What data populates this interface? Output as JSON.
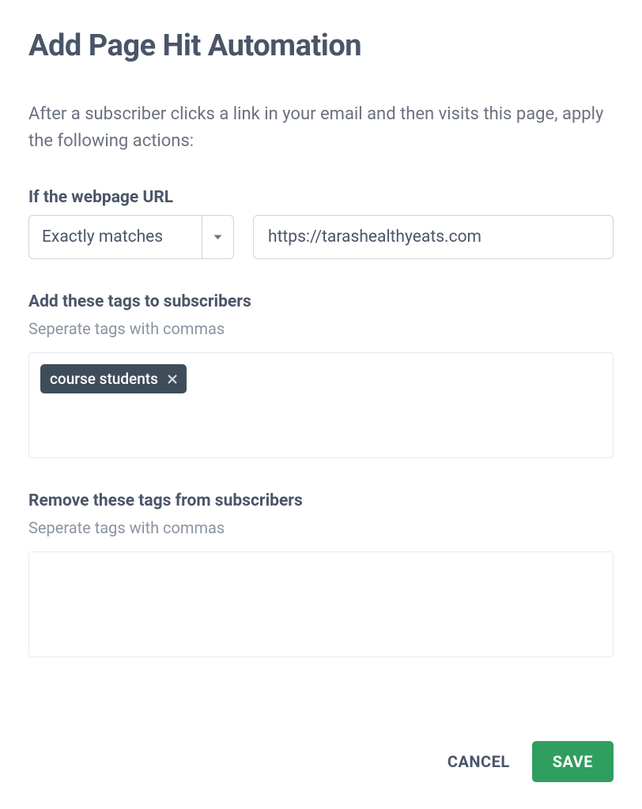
{
  "title": "Add Page Hit Automation",
  "description": "After a subscriber clicks a link in your email and then visits this page, apply the following actions:",
  "url_section": {
    "label": "If the webpage URL",
    "match_mode": "Exactly matches",
    "url_value": "https://tarashealthyeats.com"
  },
  "add_tags": {
    "label": "Add these tags to subscribers",
    "sublabel": "Seperate tags with commas",
    "tags": [
      "course students"
    ]
  },
  "remove_tags": {
    "label": "Remove these tags from subscribers",
    "sublabel": "Seperate tags with commas",
    "tags": []
  },
  "buttons": {
    "cancel": "CANCEL",
    "save": "SAVE"
  }
}
